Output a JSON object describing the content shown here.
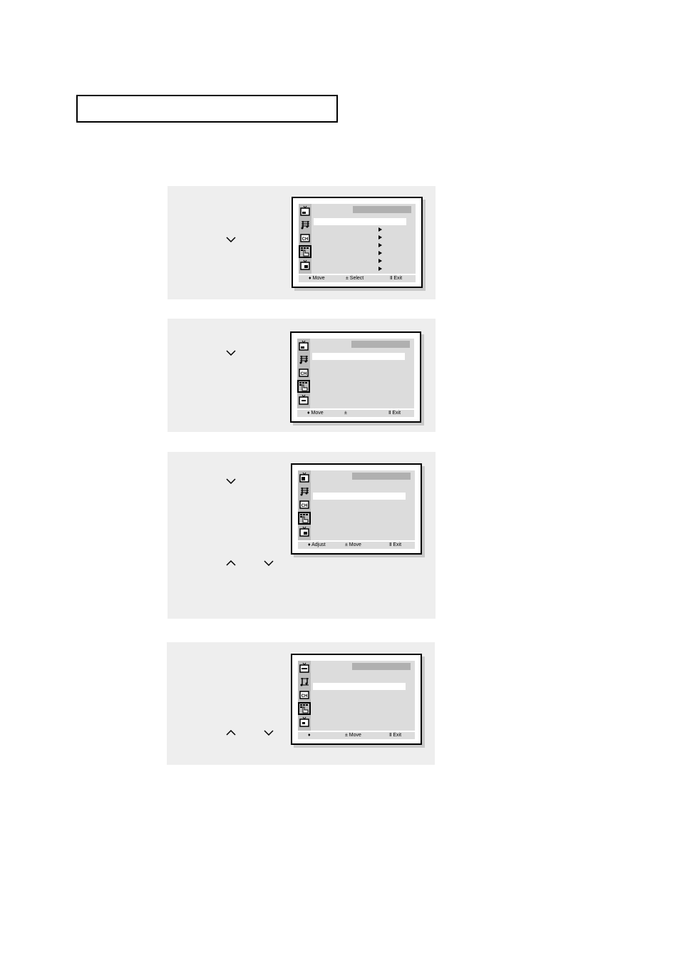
{
  "page": {
    "title_box_text": ""
  },
  "icons": {
    "picture": "tv-picture-icon",
    "sound": "music-note-icon",
    "channel": "ch-icon",
    "setup": "setup-hand-icon",
    "pip": "tv-pip-icon",
    "chevron_down": "chevron-down-icon",
    "chevron_up": "chevron-up-icon",
    "submenu_arrow": "triangle-right-icon"
  },
  "colors": {
    "panel_bg": "#eeeeee",
    "osd_bg": "#dcdcdc",
    "osd_sidebar": "#bdbdbd",
    "osd_titlebar": "#b0b0b0",
    "osd_highlight": "#ffffff"
  },
  "steps": [
    {
      "footer": {
        "left": "♦ Move",
        "center": "± Select",
        "right": "Ⅱ Exit"
      },
      "submenu_arrows": 6
    },
    {
      "footer": {
        "left": "♦ Move",
        "center": "±",
        "right": "Ⅱ Exit"
      },
      "submenu_arrows": 0
    },
    {
      "footer": {
        "left": "♦ Adjust",
        "center": "± Move",
        "right": "Ⅱ Exit"
      },
      "submenu_arrows": 0
    },
    {
      "footer": {
        "left": "♦",
        "center": "± Move",
        "right": "Ⅱ Exit"
      },
      "submenu_arrows": 0
    }
  ]
}
